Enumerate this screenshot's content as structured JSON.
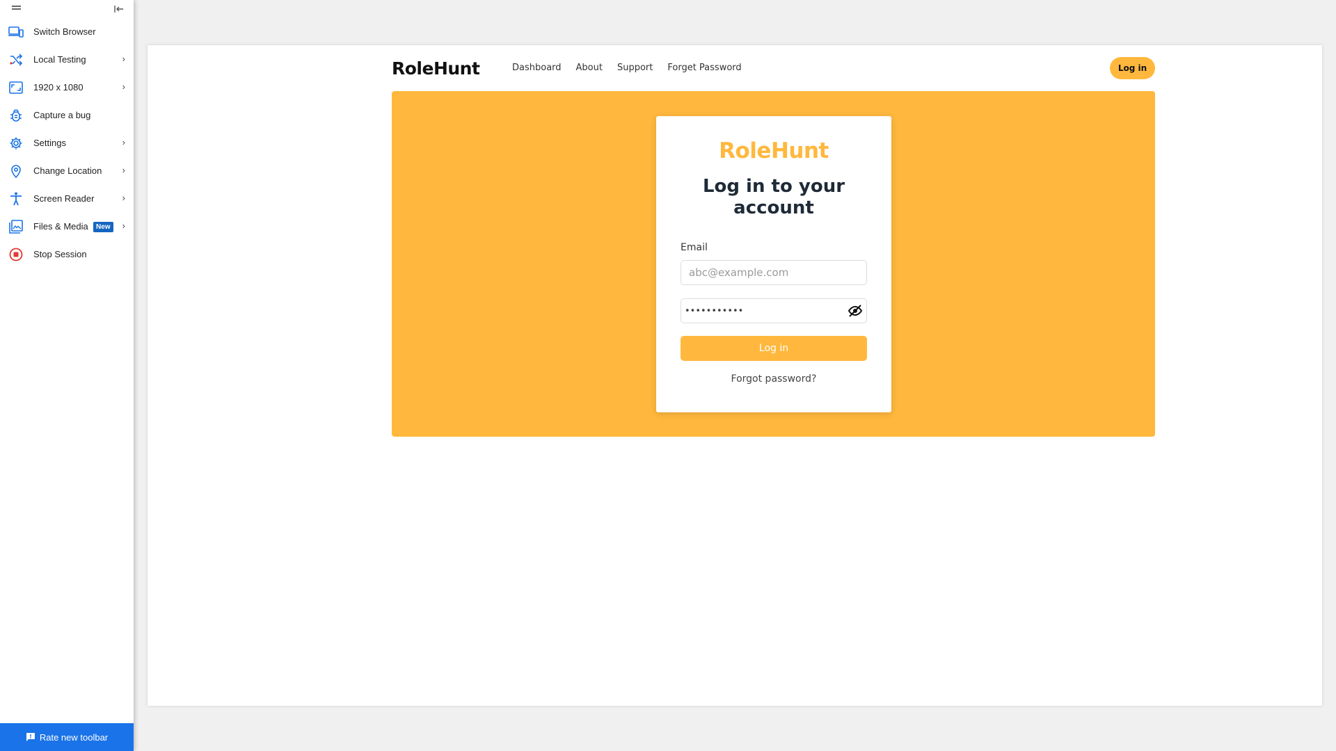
{
  "toolbar": {
    "items": [
      {
        "label": "Switch Browser",
        "icon": "devices-icon",
        "has_chevron": false
      },
      {
        "label": "Local Testing",
        "icon": "shuffle-icon",
        "has_chevron": true
      },
      {
        "label": "1920 x 1080",
        "icon": "resolution-icon",
        "has_chevron": true
      },
      {
        "label": "Capture a bug",
        "icon": "bug-icon",
        "has_chevron": false
      },
      {
        "label": "Settings",
        "icon": "gear-icon",
        "has_chevron": true
      },
      {
        "label": "Change Location",
        "icon": "location-pin-icon",
        "has_chevron": true
      },
      {
        "label": "Screen Reader",
        "icon": "accessibility-icon",
        "has_chevron": true
      },
      {
        "label": "Files & Media",
        "icon": "image-icon",
        "has_chevron": true,
        "badge": "New"
      },
      {
        "label": "Stop Session",
        "icon": "stop-icon",
        "has_chevron": false
      }
    ],
    "chevron": "›",
    "rate_label": "Rate new toolbar"
  },
  "site": {
    "brand": "RoleHunt",
    "nav": [
      "Dashboard",
      "About",
      "Support",
      "Forget Password"
    ],
    "nav_login": "Log in"
  },
  "login_card": {
    "brand": "RoleHunt",
    "title": "Log in to your account",
    "email_label": "Email",
    "email_placeholder": "abc@example.com",
    "password_mask": "•••••••••••",
    "submit_label": "Log in",
    "forgot_label": "Forgot password?"
  },
  "colors": {
    "accent": "#ffb83d",
    "toolbar_blue": "#1a73e8",
    "stop_red": "#e53935"
  }
}
